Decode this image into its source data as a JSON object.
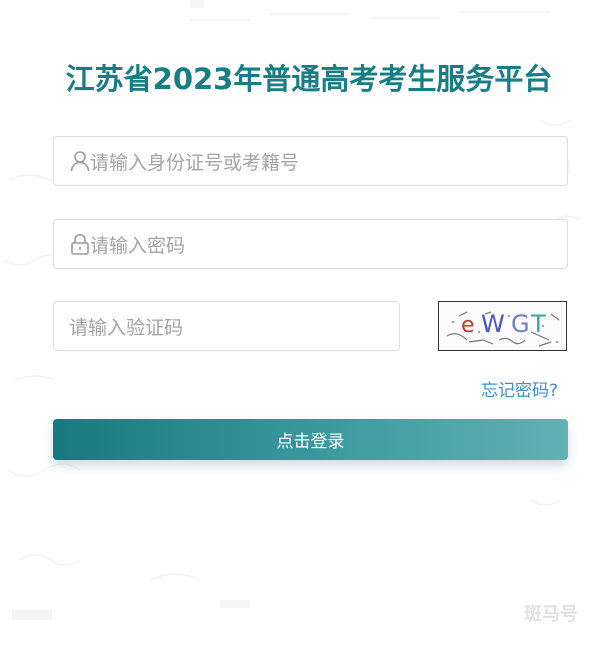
{
  "header": {
    "title": "江苏省2023年普通高考考生服务平台"
  },
  "form": {
    "id_field": {
      "placeholder": "请输入身份证号或考籍号",
      "icon": "user-icon"
    },
    "password_field": {
      "placeholder": "请输入密码",
      "icon": "lock-icon"
    },
    "captcha_field": {
      "placeholder": "请输入验证码"
    },
    "captcha_image": {
      "text": "eWGT"
    },
    "forgot_password_label": "忘记密码?",
    "login_label": "点击登录"
  },
  "watermark": "斑马号",
  "colors": {
    "title": "#167e84",
    "link": "#3a8fcf",
    "button_start": "#17797f",
    "button_end": "#62b0b4",
    "placeholder": "#a4a4a4",
    "border": "#dcdcdc"
  }
}
